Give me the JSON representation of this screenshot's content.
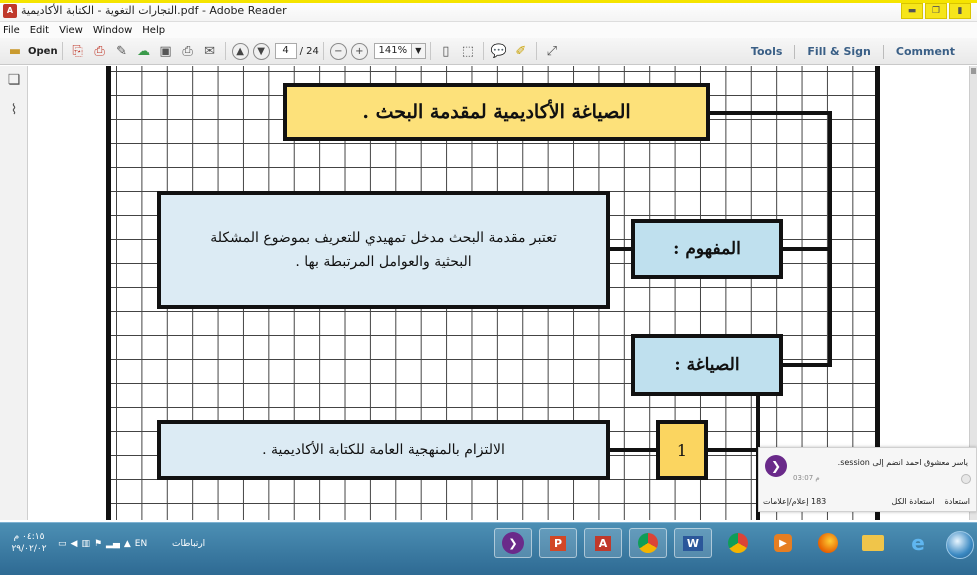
{
  "window": {
    "title": "التجارات التغوية - الكتابة الأكاديمية.pdf - Adobe Reader"
  },
  "menu": [
    "File",
    "Edit",
    "View",
    "Window",
    "Help"
  ],
  "toolbar": {
    "open_label": "Open",
    "page_current": "4",
    "page_total": "/ 24",
    "zoom": "141%",
    "tools": "Tools",
    "fill_sign": "Fill & Sign",
    "comment": "Comment"
  },
  "document": {
    "title": "الصياغة الأكاديمية لمقدمة البحث .",
    "concept_label": "المفهوم :",
    "definition_line1": "تعتبر مقدمة البحث مدخل تمهيدي للتعريف بموضوع المشكلة",
    "definition_line2": "البحثية والعوامل المرتبطة بها .",
    "formulation_label": "الصياغة :",
    "item_number": "1",
    "item_text": "الالتزام بالمنهجية العامة للكتابة الأكاديمية ."
  },
  "notification": {
    "message": "ياسر معشوق احمد انضم إلى session.",
    "time": "03:07 م",
    "restore_all": "استعادة الكل",
    "restore": "استعادة",
    "count": "183 إعلام/إعلامات"
  },
  "taskbar": {
    "time": "٠٤:١٥ م",
    "date": "٢٩/٠٢/٠٢",
    "lang": "EN",
    "connections": "ارتباطات"
  },
  "colors": {
    "title_box": "#fde17a",
    "concept_box": "#bfe0ee",
    "text_box": "#dcebf4",
    "number_box": "#fbd560",
    "taskbar": "#2e6a93",
    "titlebar_accent": "#f5e400"
  }
}
